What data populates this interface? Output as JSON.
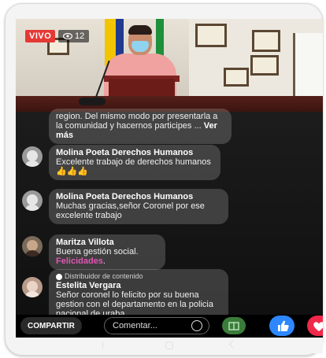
{
  "live_badge": "VIVO",
  "viewer_count": "12",
  "comments": [
    {
      "name": "",
      "text": "region. Del mismo modo por presentarla a la comunidad y hacernos participes ...",
      "see_more": "Ver más"
    },
    {
      "name": "Molina Poeta Derechos Humanos",
      "text": "Excelente trabajo de derechos humanos 👍👍👍"
    },
    {
      "name": "Molina Poeta Derechos Humanos",
      "text": "Muchas gracias,señor Coronel por ese excelente trabajo"
    },
    {
      "name": "Maritza Villota",
      "text": "Buena gestión social.",
      "highlight": "Felicidades",
      "text_end": "."
    },
    {
      "badge": "Distribuidor de contenido",
      "name": "Estelita Vergara",
      "text": "Señor coronel lo felicito por su buena gestion con el departamento en la policia nacional de uraba"
    }
  ],
  "bottom_bar": {
    "share_label": "COMPARTIR",
    "comment_placeholder": "Comentar...",
    "smile_icon": "smile-icon",
    "gift_icon": "gift-icon",
    "like_icon": "like-icon",
    "heart_icon": "heart-icon"
  },
  "colors": {
    "live_red": "#e53935",
    "like_blue": "#2d88ff",
    "heart_red": "#f0284a",
    "highlight_pink": "#e056b4"
  }
}
